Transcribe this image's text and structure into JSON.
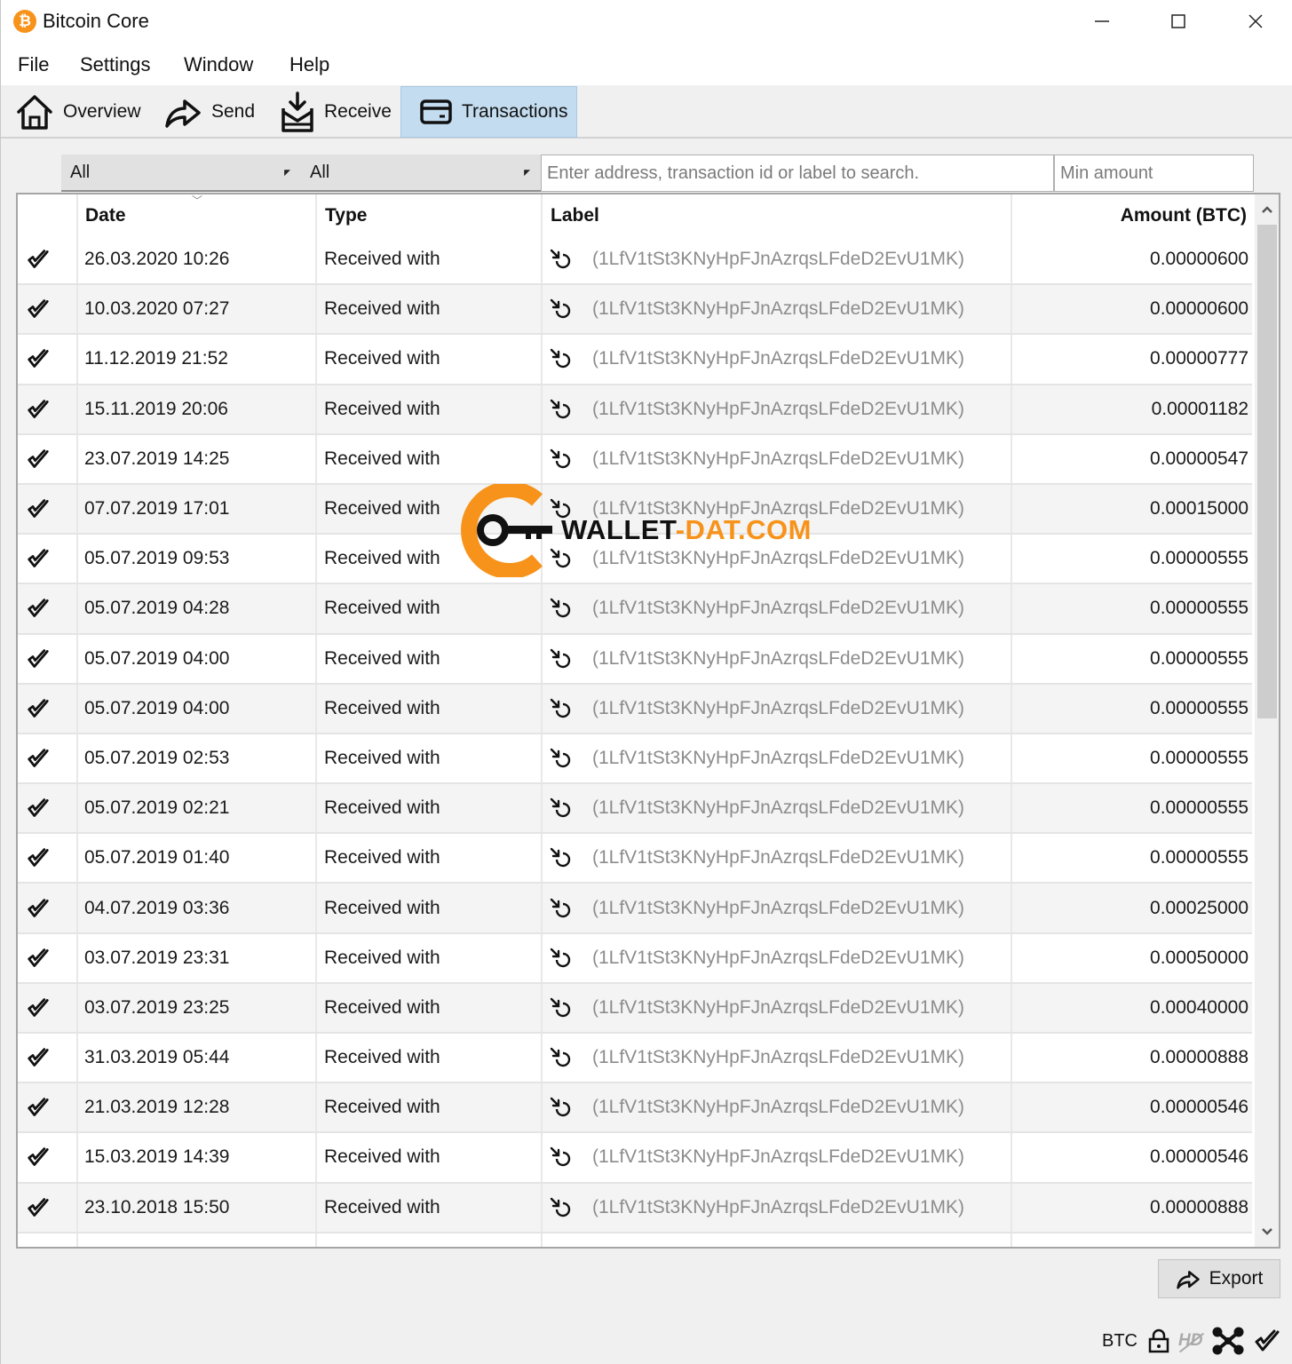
{
  "window": {
    "title": "Bitcoin Core",
    "app_icon_glyph": "₿",
    "controls": [
      "minimize-icon",
      "maximize-icon",
      "close-icon"
    ]
  },
  "menu": [
    "File",
    "Settings",
    "Window",
    "Help"
  ],
  "toolbar": {
    "tabs": [
      {
        "label": "Overview",
        "icon": "home-icon",
        "active": false
      },
      {
        "label": "Send",
        "icon": "send-arrow-icon",
        "active": false
      },
      {
        "label": "Receive",
        "icon": "receive-inbox-icon",
        "active": false
      },
      {
        "label": "Transactions",
        "icon": "wallet-card-icon",
        "active": true
      }
    ],
    "active_color": "#c3dcf0"
  },
  "filters": {
    "date_filter": "All",
    "type_filter": "All",
    "search_placeholder": "Enter address, transaction id or label to search.",
    "min_amount_placeholder": "Min amount"
  },
  "table": {
    "columns": [
      "",
      "Date",
      "Type",
      "Label",
      "Amount (BTC)"
    ],
    "sorted_by": "Date",
    "sort_order": "descending",
    "rows": [
      {
        "status": "confirmed",
        "date": "26.03.2020 10:26",
        "type": "Received with",
        "label": "(1LfV1tSt3KNyHpFJnAzrqsLFdeD2EvU1MK)",
        "amount": "0.00000600"
      },
      {
        "status": "confirmed",
        "date": "10.03.2020 07:27",
        "type": "Received with",
        "label": "(1LfV1tSt3KNyHpFJnAzrqsLFdeD2EvU1MK)",
        "amount": "0.00000600"
      },
      {
        "status": "confirmed",
        "date": "11.12.2019 21:52",
        "type": "Received with",
        "label": "(1LfV1tSt3KNyHpFJnAzrqsLFdeD2EvU1MK)",
        "amount": "0.00000777"
      },
      {
        "status": "confirmed",
        "date": "15.11.2019 20:06",
        "type": "Received with",
        "label": "(1LfV1tSt3KNyHpFJnAzrqsLFdeD2EvU1MK)",
        "amount": "0.00001182"
      },
      {
        "status": "confirmed",
        "date": "23.07.2019 14:25",
        "type": "Received with",
        "label": "(1LfV1tSt3KNyHpFJnAzrqsLFdeD2EvU1MK)",
        "amount": "0.00000547"
      },
      {
        "status": "confirmed",
        "date": "07.07.2019 17:01",
        "type": "Received with",
        "label": "(1LfV1tSt3KNyHpFJnAzrqsLFdeD2EvU1MK)",
        "amount": "0.00015000"
      },
      {
        "status": "confirmed",
        "date": "05.07.2019 09:53",
        "type": "Received with",
        "label": "(1LfV1tSt3KNyHpFJnAzrqsLFdeD2EvU1MK)",
        "amount": "0.00000555"
      },
      {
        "status": "confirmed",
        "date": "05.07.2019 04:28",
        "type": "Received with",
        "label": "(1LfV1tSt3KNyHpFJnAzrqsLFdeD2EvU1MK)",
        "amount": "0.00000555"
      },
      {
        "status": "confirmed",
        "date": "05.07.2019 04:00",
        "type": "Received with",
        "label": "(1LfV1tSt3KNyHpFJnAzrqsLFdeD2EvU1MK)",
        "amount": "0.00000555"
      },
      {
        "status": "confirmed",
        "date": "05.07.2019 04:00",
        "type": "Received with",
        "label": "(1LfV1tSt3KNyHpFJnAzrqsLFdeD2EvU1MK)",
        "amount": "0.00000555"
      },
      {
        "status": "confirmed",
        "date": "05.07.2019 02:53",
        "type": "Received with",
        "label": "(1LfV1tSt3KNyHpFJnAzrqsLFdeD2EvU1MK)",
        "amount": "0.00000555"
      },
      {
        "status": "confirmed",
        "date": "05.07.2019 02:21",
        "type": "Received with",
        "label": "(1LfV1tSt3KNyHpFJnAzrqsLFdeD2EvU1MK)",
        "amount": "0.00000555"
      },
      {
        "status": "confirmed",
        "date": "05.07.2019 01:40",
        "type": "Received with",
        "label": "(1LfV1tSt3KNyHpFJnAzrqsLFdeD2EvU1MK)",
        "amount": "0.00000555"
      },
      {
        "status": "confirmed",
        "date": "04.07.2019 03:36",
        "type": "Received with",
        "label": "(1LfV1tSt3KNyHpFJnAzrqsLFdeD2EvU1MK)",
        "amount": "0.00025000"
      },
      {
        "status": "confirmed",
        "date": "03.07.2019 23:31",
        "type": "Received with",
        "label": "(1LfV1tSt3KNyHpFJnAzrqsLFdeD2EvU1MK)",
        "amount": "0.00050000"
      },
      {
        "status": "confirmed",
        "date": "03.07.2019 23:25",
        "type": "Received with",
        "label": "(1LfV1tSt3KNyHpFJnAzrqsLFdeD2EvU1MK)",
        "amount": "0.00040000"
      },
      {
        "status": "confirmed",
        "date": "31.03.2019 05:44",
        "type": "Received with",
        "label": "(1LfV1tSt3KNyHpFJnAzrqsLFdeD2EvU1MK)",
        "amount": "0.00000888"
      },
      {
        "status": "confirmed",
        "date": "21.03.2019 12:28",
        "type": "Received with",
        "label": "(1LfV1tSt3KNyHpFJnAzrqsLFdeD2EvU1MK)",
        "amount": "0.00000546"
      },
      {
        "status": "confirmed",
        "date": "15.03.2019 14:39",
        "type": "Received with",
        "label": "(1LfV1tSt3KNyHpFJnAzrqsLFdeD2EvU1MK)",
        "amount": "0.00000546"
      },
      {
        "status": "confirmed",
        "date": "23.10.2018 15:50",
        "type": "Received with",
        "label": "(1LfV1tSt3KNyHpFJnAzrqsLFdeD2EvU1MK)",
        "amount": "0.00000888"
      }
    ],
    "partial_row_visible": true,
    "scroll_position": 0.0
  },
  "watermark": {
    "text_dark": "WALLET",
    "text_accent": "-DAT.COM",
    "accent_color": "#f7931a"
  },
  "export_label": "Export",
  "statusbar": {
    "unit": "BTC",
    "hd_label": "HD",
    "icons": [
      "lock-icon",
      "hd-disabled-icon",
      "network-icon",
      "synced-check-icon"
    ]
  }
}
